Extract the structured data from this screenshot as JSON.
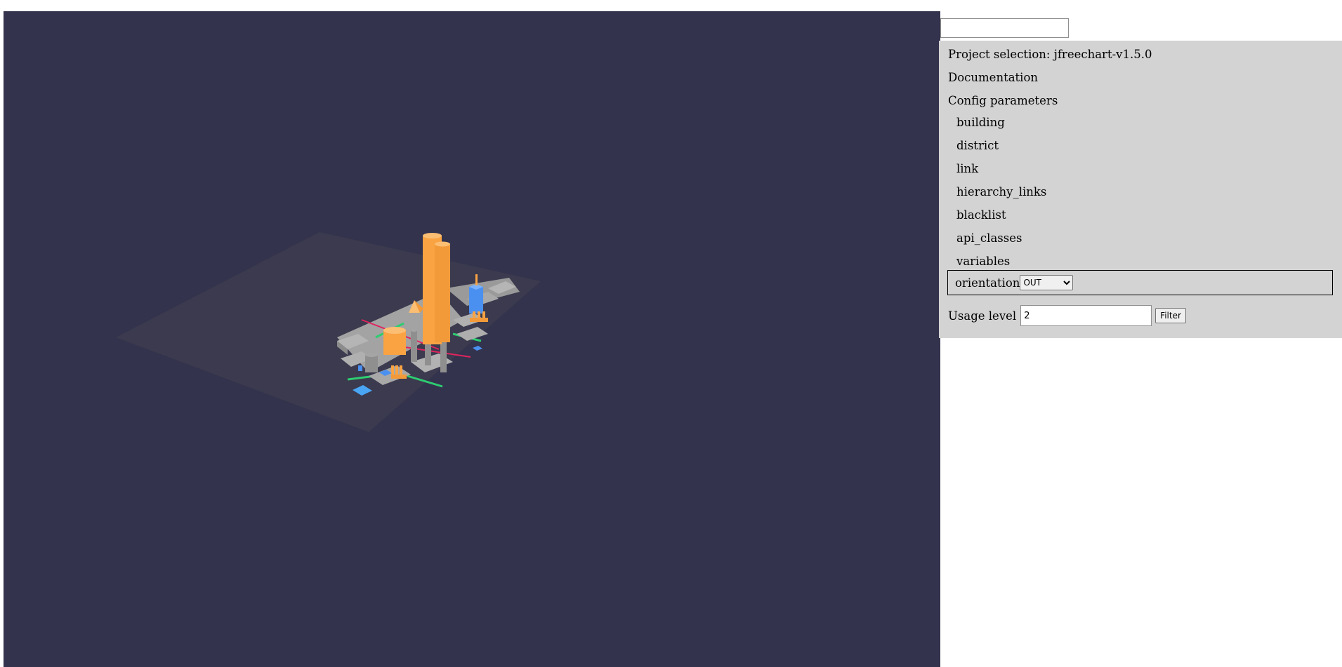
{
  "search": {
    "value": "",
    "placeholder": ""
  },
  "menu": {
    "project_selection": "Project selection: jfreechart-v1.5.0",
    "documentation": "Documentation",
    "config_parameters": "Config parameters",
    "config_items": [
      "building",
      "district",
      "link",
      "hierarchy_links",
      "blacklist",
      "api_classes",
      "variables"
    ],
    "orientation": {
      "label": "orientation",
      "selected": "OUT"
    },
    "usage_level": {
      "label": "Usage level",
      "value": "2",
      "filter_label": "Filter"
    }
  },
  "colors": {
    "viewport_background": "#33334d",
    "panel_background": "#d3d3d3",
    "building_orange": "#f9a343",
    "building_blue": "#4a90f0",
    "building_gray": "#8c8c8c",
    "link_green": "#2ecc71",
    "link_red": "#e0245e"
  }
}
